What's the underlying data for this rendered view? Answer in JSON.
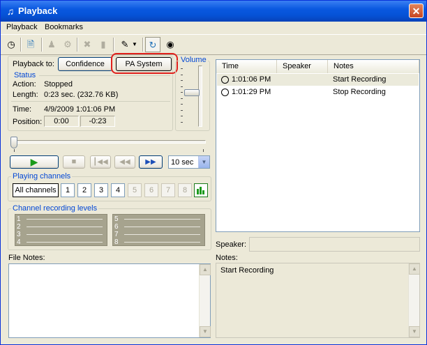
{
  "window": {
    "title": "Playback"
  },
  "menu": [
    "Playback",
    "Bookmarks"
  ],
  "playback_to": {
    "label": "Playback to:",
    "options": [
      "Confidence",
      "PA System"
    ],
    "selected": "PA System"
  },
  "status": {
    "title": "Status",
    "action_label": "Action:",
    "action_value": "Stopped",
    "length_label": "Length:",
    "length_value": "0:23 sec. (232.76 KB)",
    "time_label": "Time:",
    "time_value": "4/9/2009 1:01:06 PM",
    "position_label": "Position:",
    "position_value": "0:00",
    "remaining_value": "-0:23"
  },
  "volume": {
    "label": "Volume",
    "level_percent": 55
  },
  "transport": {
    "skip_select": "10 sec"
  },
  "playing_channels": {
    "title": "Playing channels",
    "all_label": "All channels",
    "channels": [
      {
        "label": "1",
        "enabled": true
      },
      {
        "label": "2",
        "enabled": true
      },
      {
        "label": "3",
        "enabled": true
      },
      {
        "label": "4",
        "enabled": true
      },
      {
        "label": "5",
        "enabled": false
      },
      {
        "label": "6",
        "enabled": false
      },
      {
        "label": "7",
        "enabled": false
      },
      {
        "label": "8",
        "enabled": false
      }
    ]
  },
  "recording_levels": {
    "title": "Channel recording levels",
    "left": [
      "1",
      "2",
      "3",
      "4"
    ],
    "right": [
      "5",
      "6",
      "7",
      "8"
    ]
  },
  "bookmarks_table": {
    "columns": [
      "Time",
      "Speaker",
      "Notes"
    ],
    "rows": [
      {
        "time": "1:01:06 PM",
        "speaker": "",
        "notes": "Start Recording"
      },
      {
        "time": "1:01:29 PM",
        "speaker": "",
        "notes": "Stop Recording"
      }
    ]
  },
  "speaker_label": "Speaker:",
  "notes_label": "Notes:",
  "notes_value": "Start Recording",
  "file_notes_label": "File Notes:",
  "colors": {
    "title_bar": "#0a58e0",
    "group_title": "#0046d5",
    "highlight_ring": "#e0201c",
    "play_green": "#1a9a1a"
  }
}
